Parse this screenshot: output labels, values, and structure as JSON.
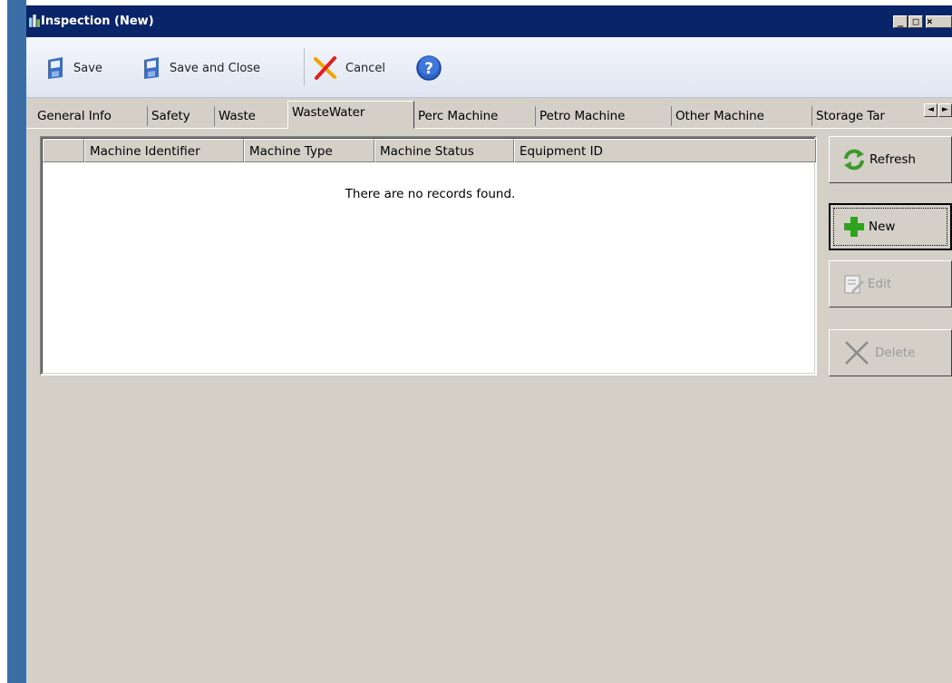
{
  "window": {
    "title": "Inspection (New)",
    "controls": [
      "_",
      "□",
      "×"
    ]
  },
  "toolbar": {
    "save_label": "Save",
    "save_close_label": "Save and Close",
    "cancel_label": "Cancel"
  },
  "tabs": {
    "items": [
      "General Info",
      "Safety",
      "Waste",
      "WasteWater",
      "Perc Machine",
      "Petro Machine",
      "Other Machine",
      "Storage Tar"
    ],
    "active": "WasteWater",
    "scroll_left": "◄",
    "scroll_right": "►"
  },
  "grid": {
    "columns": [
      "",
      "Machine Identifier",
      "Machine Type",
      "Machine Status",
      "Equipment ID"
    ],
    "empty_message": "There are no records found."
  },
  "side_buttons": {
    "refresh": "Refresh",
    "new": "New",
    "edit": "Edit",
    "delete": "Delete"
  },
  "colors": {
    "titlebar": "#0a246a",
    "face": "#d4d0c8",
    "desktop": "#3a6ea5"
  }
}
